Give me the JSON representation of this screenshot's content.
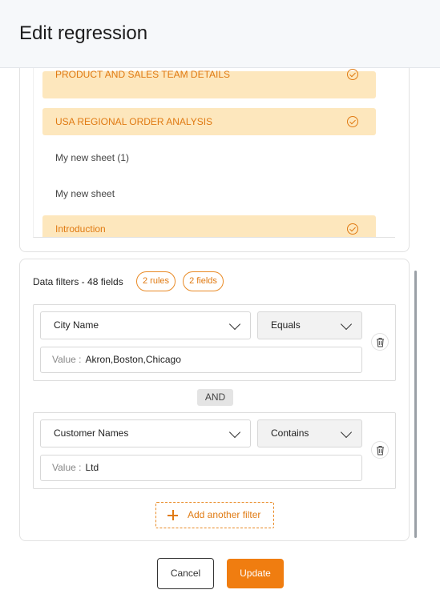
{
  "dialog": {
    "title": "Edit regression"
  },
  "sheets": {
    "items": [
      {
        "label": "PRODUCT AND SALES TEAM DETAILS",
        "selected": true
      },
      {
        "label": "USA REGIONAL ORDER ANALYSIS",
        "selected": true
      },
      {
        "label": "My new sheet (1)",
        "selected": false
      },
      {
        "label": "My new sheet",
        "selected": false
      },
      {
        "label": "Introduction",
        "selected": true
      }
    ]
  },
  "filters": {
    "title": "Data filters - 48 fields",
    "rules_badge": "2 rules",
    "fields_badge": "2 fields",
    "value_label": "Value :",
    "conjunction": "AND",
    "rules": [
      {
        "field": "City Name",
        "operator": "Equals",
        "value": "Akron,Boston,Chicago"
      },
      {
        "field": "Customer Names",
        "operator": "Contains",
        "value": "Ltd"
      }
    ],
    "add_label": "Add another filter"
  },
  "actions": {
    "cancel": "Cancel",
    "update": "Update"
  },
  "colors": {
    "accent": "#f07d10",
    "selected_bg": "#fde7bd",
    "header_bg": "#f6f8fa"
  }
}
